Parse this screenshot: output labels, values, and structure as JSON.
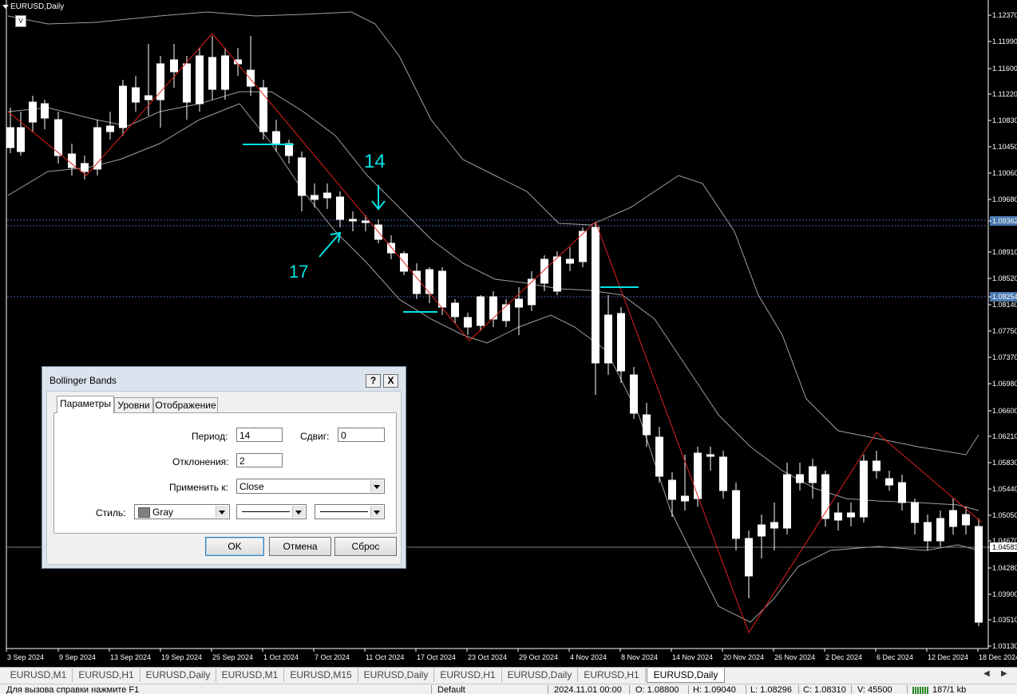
{
  "chart": {
    "symbol_title": "EURUSD,Daily",
    "indicator_box": "V",
    "price_labels": [
      "1.12370",
      "1.11990",
      "1.11600",
      "1.11220",
      "1.10830",
      "1.10450",
      "1.10060",
      "1.09680",
      "1.09362",
      "1.08910",
      "1.08520",
      "1.08254",
      "1.08140",
      "1.07750",
      "1.07370",
      "1.06980",
      "1.06600",
      "1.06210",
      "1.05830",
      "1.05440",
      "1.05050",
      "1.04670",
      "1.04583",
      "1.04280",
      "1.03900",
      "1.03510",
      "1.03130"
    ],
    "highlighted_prices": [
      "1.09362",
      "1.08254",
      "1.04583"
    ],
    "date_labels": [
      "3 Sep 2024",
      "9 Sep 2024",
      "13 Sep 2024",
      "19 Sep 2024",
      "25 Sep 2024",
      "1 Oct 2024",
      "7 Oct 2024",
      "11 Oct 2024",
      "17 Oct 2024",
      "23 Oct 2024",
      "29 Oct 2024",
      "4 Nov 2024",
      "8 Nov 2024",
      "14 Nov 2024",
      "20 Nov 2024",
      "26 Nov 2024",
      "2 Dec 2024",
      "6 Dec 2024",
      "12 Dec 2024",
      "18 Dec 2024"
    ],
    "annotations": [
      "14",
      "17"
    ],
    "colors": {
      "background": "#000000",
      "candle_bull": "#ffffff",
      "bands": "#a0a0a0",
      "zigzag": "#e02020",
      "markup": "#00e5e5",
      "grid_line": "#4060a0"
    }
  },
  "tabs": {
    "items": [
      "EURUSD,M1",
      "EURUSD,H1",
      "EURUSD,Daily",
      "EURUSD,M1",
      "EURUSD,M15",
      "EURUSD,Daily",
      "EURUSD,H1",
      "EURUSD,Daily",
      "EURUSD,H1",
      "EURUSD,Daily"
    ],
    "active_index": 9
  },
  "status": {
    "help": "Для вызова справки нажмите F1",
    "profile": "Default",
    "datetime": "2024.11.01 00:00",
    "open": "O: 1.08800",
    "high": "H: 1.09040",
    "low": "L: 1.08296",
    "close": "C: 1.08310",
    "volume": "V: 45500",
    "traffic": "187/1 kb"
  },
  "dialog": {
    "title": "Bollinger Bands",
    "help_btn": "?",
    "close_btn": "X",
    "tabs": [
      "Параметры",
      "Уровни",
      "Отображение"
    ],
    "period_label": "Период:",
    "period_value": "14",
    "shift_label": "Сдвиг:",
    "shift_value": "0",
    "deviation_label": "Отклонения:",
    "deviation_value": "2",
    "apply_label": "Применить к:",
    "apply_value": "Close",
    "style_label": "Стиль:",
    "style_color": "Gray",
    "ok": "OK",
    "cancel": "Отмена",
    "reset": "Сброс"
  }
}
